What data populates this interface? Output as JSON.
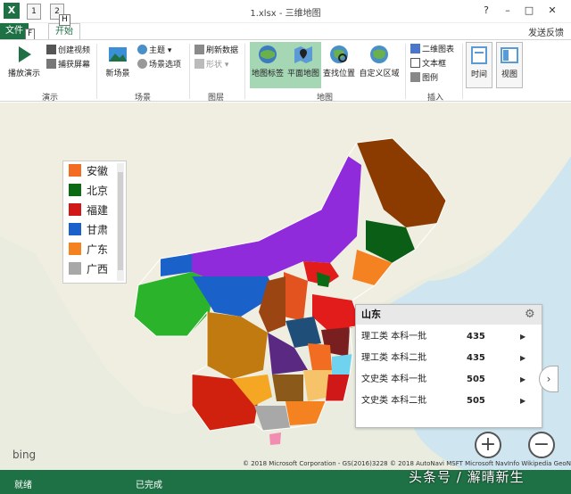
{
  "app": {
    "title": "1.xlsx - 三维地图",
    "icon_letter": "X",
    "qat": [
      "1",
      "2"
    ],
    "window_controls": [
      "?",
      "–",
      "□",
      "✕"
    ]
  },
  "tabs": {
    "file": "文件",
    "home": "开始",
    "file_key": "F",
    "home_key": "H",
    "feedback": "发送反馈"
  },
  "ribbon": {
    "groups": {
      "demo": "演示",
      "scene": "场景",
      "layer": "图层",
      "map": "地图",
      "insert": "插入"
    },
    "play_tour": "播放演示",
    "create_video": "创建视频",
    "capture_screen": "捕获屏幕",
    "new_scene": "新场景",
    "theme": "主题",
    "scene_options": "场景选项",
    "refresh_data": "刷新数据",
    "shape": "形状",
    "map_labels": "地图标签",
    "flat_map": "平面地图",
    "find_location": "查找位置",
    "custom_region": "自定义区域",
    "chart_2d": "二维图表",
    "text_box": "文本框",
    "legend": "图例",
    "time": "时间",
    "view": "视图"
  },
  "legend": {
    "items": [
      {
        "label": "安徽",
        "color": "#f26d21"
      },
      {
        "label": "北京",
        "color": "#0a6b14"
      },
      {
        "label": "福建",
        "color": "#d01818"
      },
      {
        "label": "甘肃",
        "color": "#1a62c9"
      },
      {
        "label": "广东",
        "color": "#f58220"
      },
      {
        "label": "广西",
        "color": "#a8a8a8"
      }
    ]
  },
  "card": {
    "title": "山东",
    "rows": [
      {
        "label": "理工类 本科一批",
        "value": "435"
      },
      {
        "label": "理工类 本科二批",
        "value": "435"
      },
      {
        "label": "文史类 本科一批",
        "value": "505"
      },
      {
        "label": "文史类 本科二批",
        "value": "505"
      }
    ]
  },
  "map": {
    "zoom_in": "+",
    "zoom_out": "−",
    "next": "›",
    "bing": "bing",
    "copyright": "© 2018 Microsoft Corporation - GS(2016)3228  © 2018 AutoNavi  MSFT  Microsoft  NavInfo  Wikipedia  GeoNames"
  },
  "status": {
    "ready": "就绪",
    "done": "已完成"
  },
  "watermark": "头条号 / 澥晴新生"
}
